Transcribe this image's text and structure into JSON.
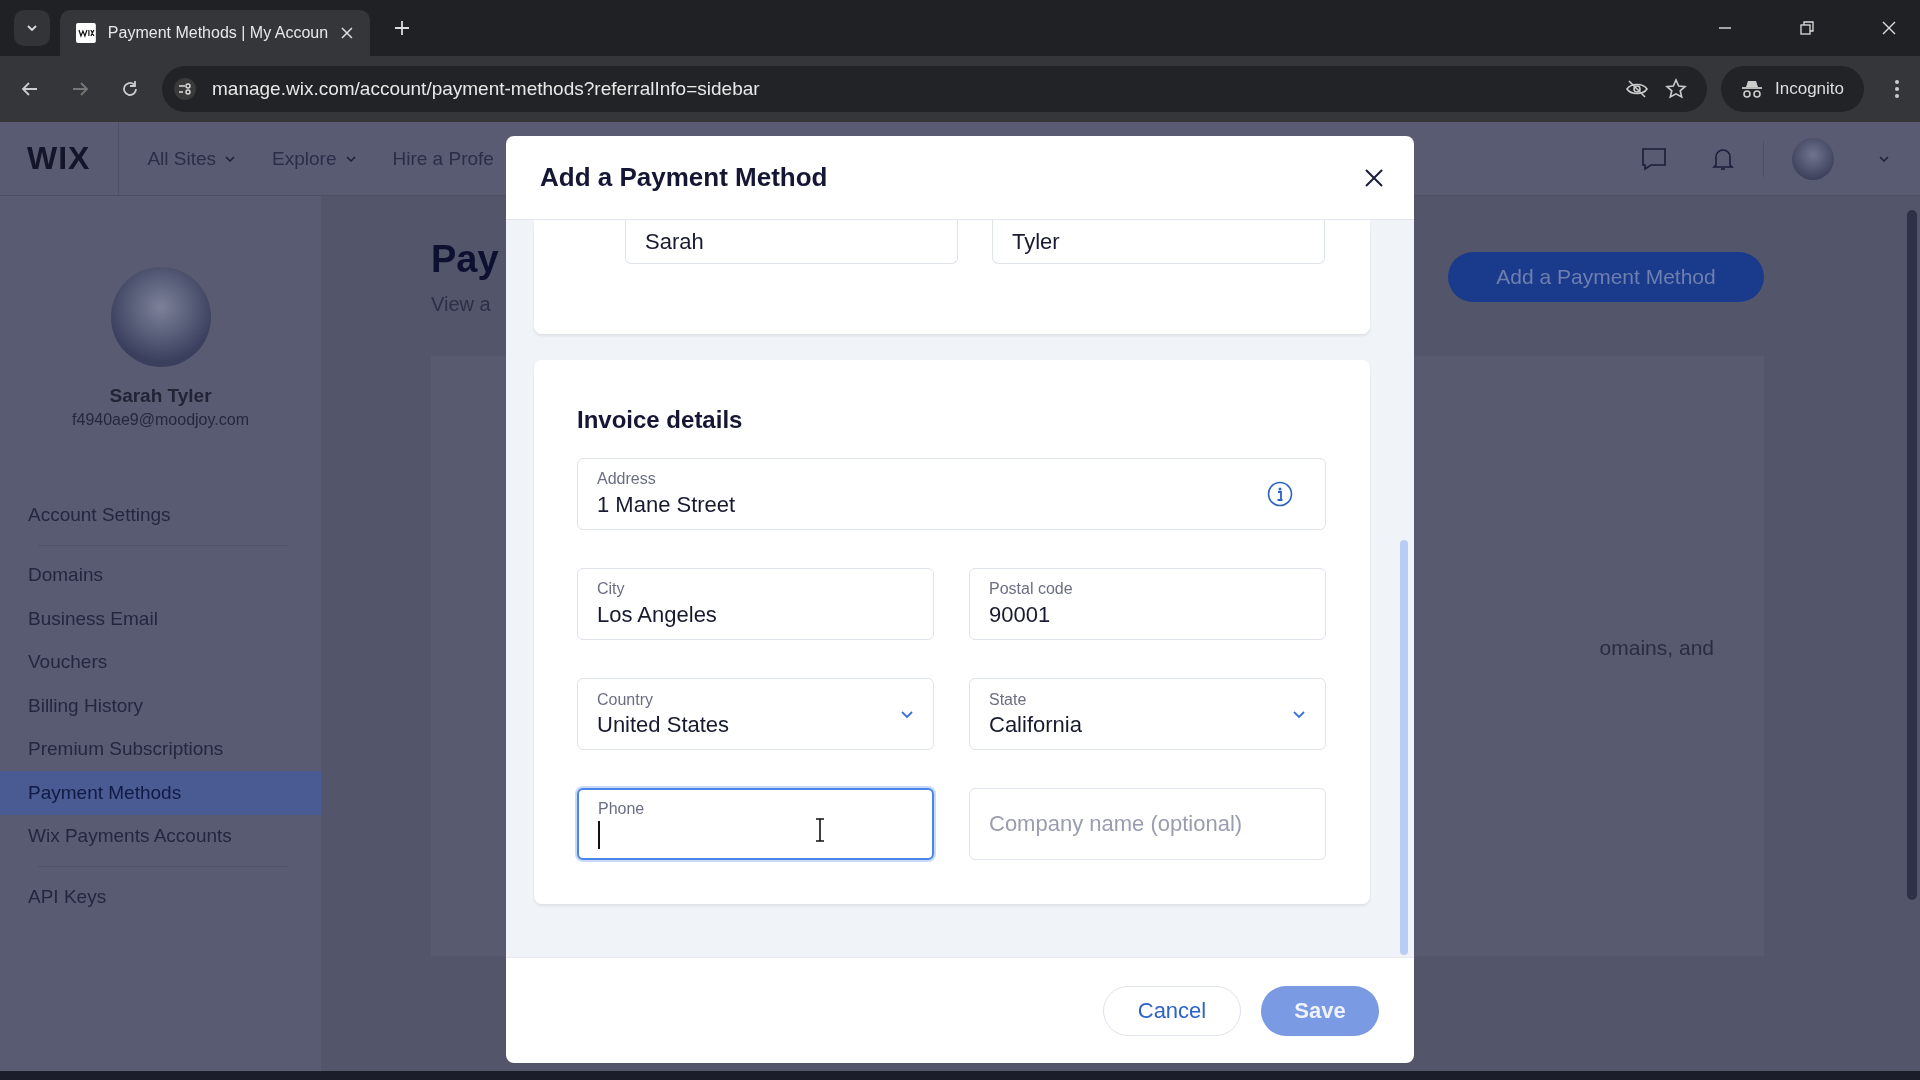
{
  "browser": {
    "tab": {
      "title": "Payment Methods | My Accoun",
      "selected": true
    },
    "url": "manage.wix.com/account/payment-methods?referralInfo=sidebar",
    "profile": "Incognito"
  },
  "wix_header": {
    "logo": "WIX",
    "nav": [
      {
        "label": "All Sites",
        "dropdown": true
      },
      {
        "label": "Explore",
        "dropdown": true
      },
      {
        "label": "Hire a Profe",
        "dropdown": false
      }
    ]
  },
  "sidebar": {
    "user": {
      "name": "Sarah Tyler",
      "email": "f4940ae9@moodjoy.com"
    },
    "groups": [
      [
        {
          "label": "Account Settings",
          "selected": false
        }
      ],
      [
        {
          "label": "Domains",
          "selected": false
        },
        {
          "label": "Business Email",
          "selected": false
        },
        {
          "label": "Vouchers",
          "selected": false
        },
        {
          "label": "Billing History",
          "selected": false
        },
        {
          "label": "Premium Subscriptions",
          "selected": false
        },
        {
          "label": "Payment Methods",
          "selected": true
        },
        {
          "label": "Wix Payments Accounts",
          "selected": false
        }
      ],
      [
        {
          "label": "API Keys",
          "selected": false
        }
      ]
    ]
  },
  "main": {
    "title": "Pay",
    "subtitle": "View a",
    "add_button": "Add a Payment Method",
    "body_text": "omains, and"
  },
  "modal": {
    "title": "Add a Payment Method",
    "name_fields": [
      {
        "value": "Sarah"
      },
      {
        "value": "Tyler"
      }
    ],
    "invoice": {
      "heading": "Invoice details",
      "fields": [
        {
          "kind": "text",
          "label": "Address",
          "value": "1 Mane Street",
          "info": true,
          "focused": false,
          "wide": true
        },
        {
          "kind": "text",
          "label": "City",
          "value": "Los Angeles",
          "info": false,
          "focused": false,
          "wide": false
        },
        {
          "kind": "text",
          "label": "Postal code",
          "value": "90001",
          "info": false,
          "focused": false,
          "wide": false
        },
        {
          "kind": "select",
          "label": "Country",
          "value": "United States",
          "info": false,
          "focused": false,
          "wide": false
        },
        {
          "kind": "select",
          "label": "State",
          "value": "California",
          "info": false,
          "focused": false,
          "wide": false
        },
        {
          "kind": "text",
          "label": "Phone",
          "info": false,
          "focused": true,
          "wide": false
        },
        {
          "kind": "text",
          "placeholder": "Company name (optional)",
          "info": false,
          "focused": false,
          "wide": false
        }
      ]
    },
    "buttons": [
      {
        "kind": "secondary",
        "label": "Cancel",
        "disabled": false
      },
      {
        "kind": "primary",
        "label": "Save",
        "disabled": true
      }
    ]
  }
}
